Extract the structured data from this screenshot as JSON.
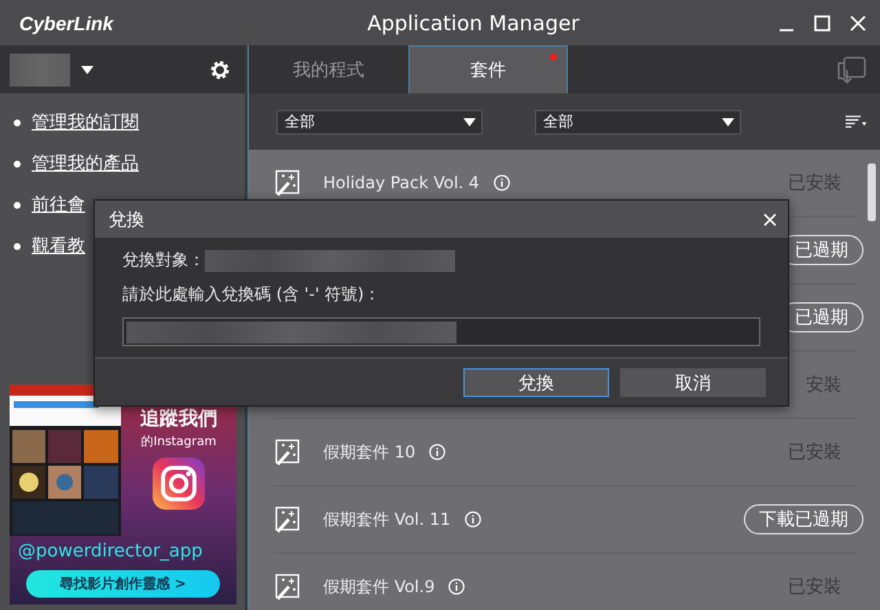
{
  "window": {
    "logo": "CyberLink",
    "title": "Application Manager"
  },
  "tabs": [
    {
      "label": "我的程式",
      "selected": false,
      "badge": false
    },
    {
      "label": "套件",
      "selected": true,
      "badge": true
    }
  ],
  "sidebar": {
    "links": [
      "管理我的訂閱",
      "管理我的產品",
      "前往會",
      "觀看教"
    ]
  },
  "banner": {
    "heading": "追蹤我們",
    "subheading": "的Instagram",
    "handle": "@powerdirector_app",
    "button": "尋找影片創作靈感 >"
  },
  "filters": [
    {
      "value": "全部"
    },
    {
      "value": "全部"
    }
  ],
  "packs": [
    {
      "name": "Holiday Pack Vol. 4",
      "status": "已安裝",
      "kind": "installed"
    },
    {
      "status": "已過期",
      "kind": "expired"
    },
    {
      "status": "已過期",
      "kind": "expired"
    },
    {
      "status": "安裝",
      "kind": "installed"
    },
    {
      "name": "假期套件 10",
      "status": "已安裝",
      "kind": "installed"
    },
    {
      "name": "假期套件 Vol. 11",
      "status": "下載已過期",
      "kind": "expired"
    },
    {
      "name": "假期套件 Vol.9",
      "status": "已安裝",
      "kind": "installed"
    }
  ],
  "dialog": {
    "title": "兌換",
    "target_label": "兌換對象：",
    "code_label": "請於此處輸入兌換碼 (含 '-' 符號)：",
    "buttons": [
      {
        "label": "兌換",
        "selected": true
      },
      {
        "label": "取消",
        "selected": false
      }
    ]
  }
}
